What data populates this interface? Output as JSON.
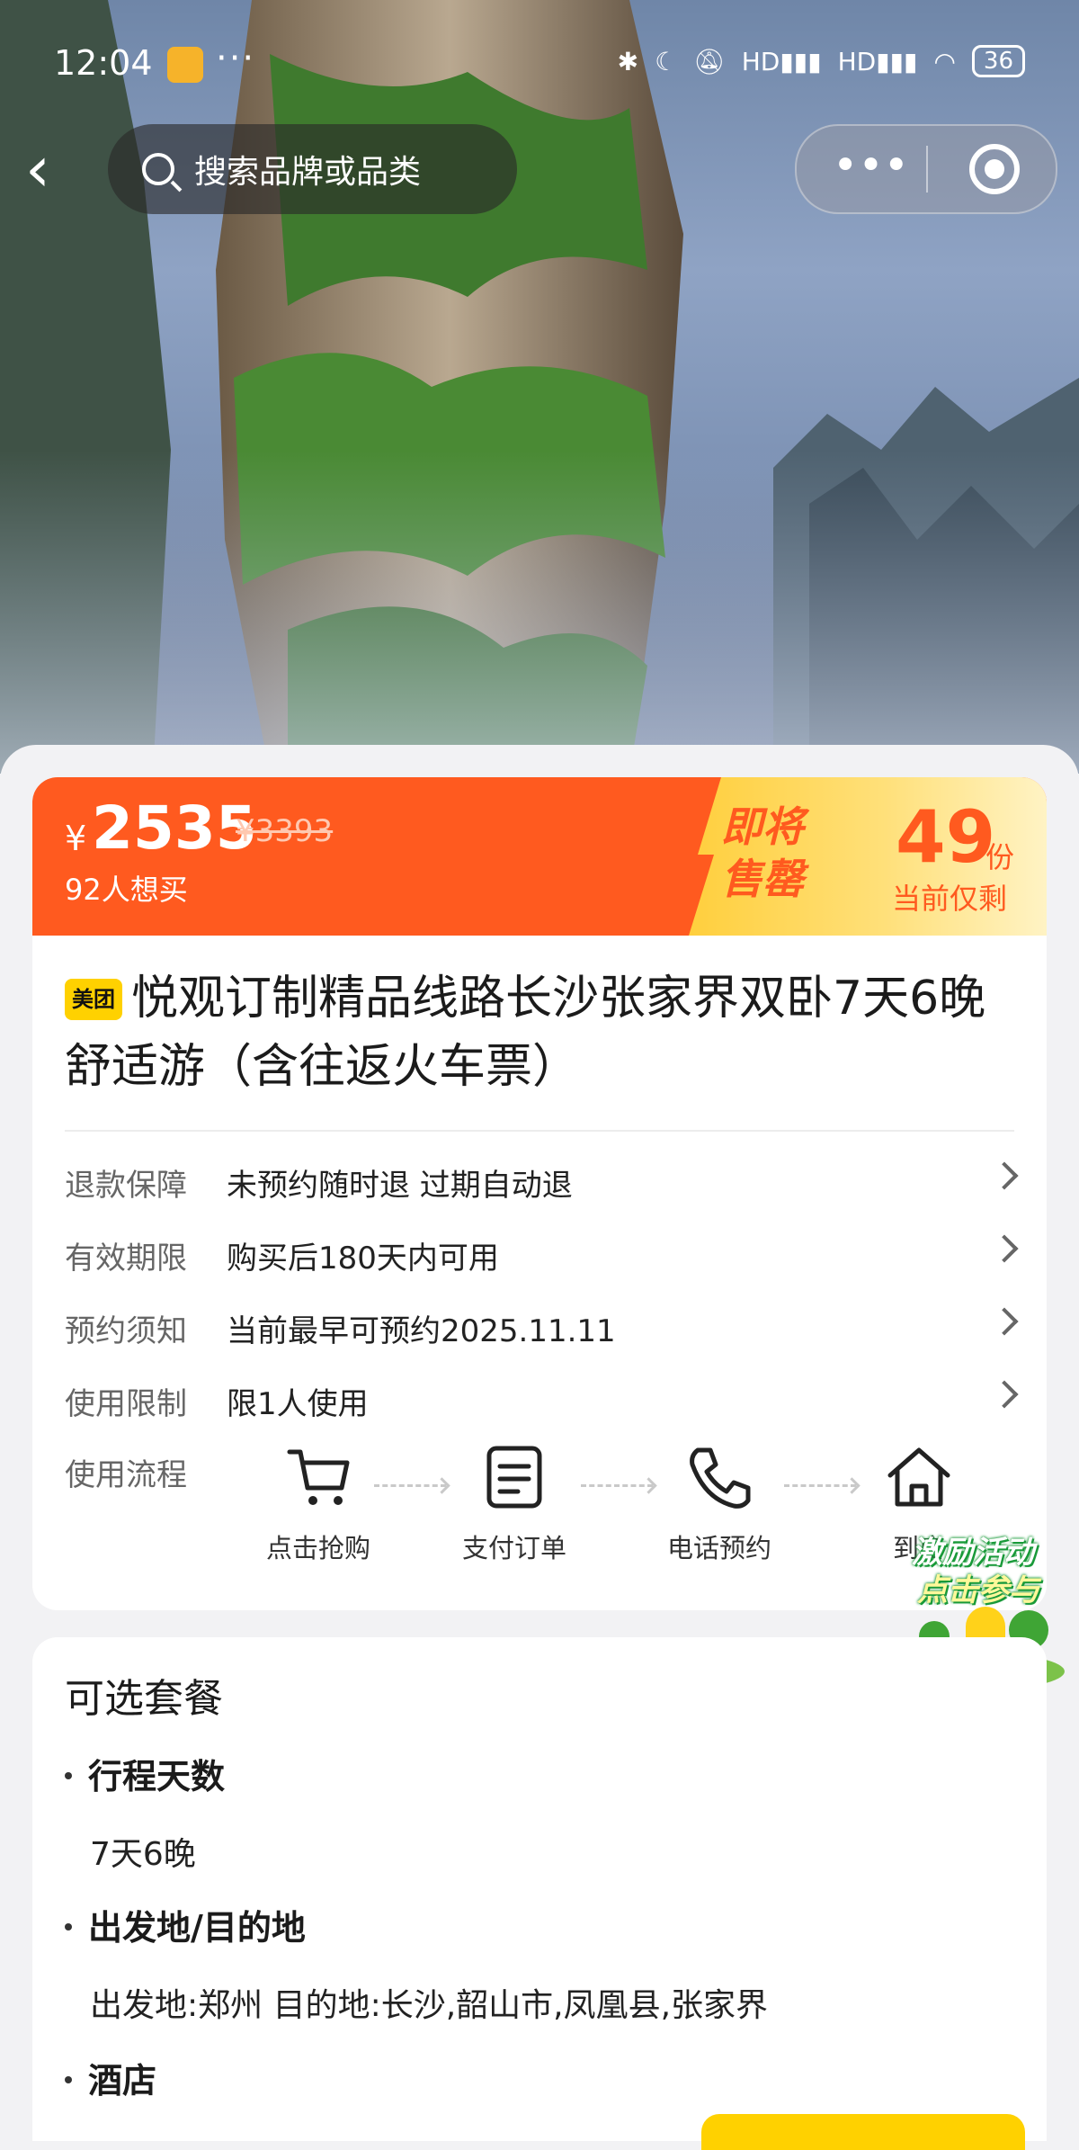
{
  "status_bar": {
    "time": "12:04",
    "dots": "···",
    "network": "HD",
    "battery": "36"
  },
  "nav": {
    "search_placeholder": "搜索品牌或品类",
    "more": "•••"
  },
  "price_banner": {
    "currency": "¥",
    "price": "2535",
    "original_price": "¥3393",
    "want_count": "92人想买",
    "soon_label": "即将售罄",
    "remaining_count": "49",
    "remaining_unit": "份",
    "remaining_label": "当前仅剩"
  },
  "product": {
    "badge": "美团",
    "title": "悦观订制精品线路长沙张家界双卧7天6晚舒适游（含往返火车票）"
  },
  "info_rows": [
    {
      "key": "退款保障",
      "value": "未预约随时退 过期自动退"
    },
    {
      "key": "有效期限",
      "value": "购买后180天内可用"
    },
    {
      "key": "预约须知",
      "value": "当前最早可预约2025.11.11"
    },
    {
      "key": "使用限制",
      "value": "限1人使用"
    }
  ],
  "flow": {
    "label": "使用流程",
    "steps": [
      "点击抢购",
      "支付订单",
      "电话预约",
      "到店"
    ]
  },
  "promo": {
    "line1": "激励活动",
    "line2": "点击参与"
  },
  "packages": {
    "heading": "可选套餐",
    "options": [
      {
        "title": "行程天数",
        "value": "7天6晚"
      },
      {
        "title": "出发地/目的地",
        "value": "出发地:郑州 目的地:长沙,韶山市,凤凰县,张家界"
      },
      {
        "title": "酒店",
        "value": ""
      }
    ]
  },
  "colors": {
    "accent": "#ff5a1f",
    "badge": "#ffd100",
    "sellout_bg": "#ffd84d"
  }
}
